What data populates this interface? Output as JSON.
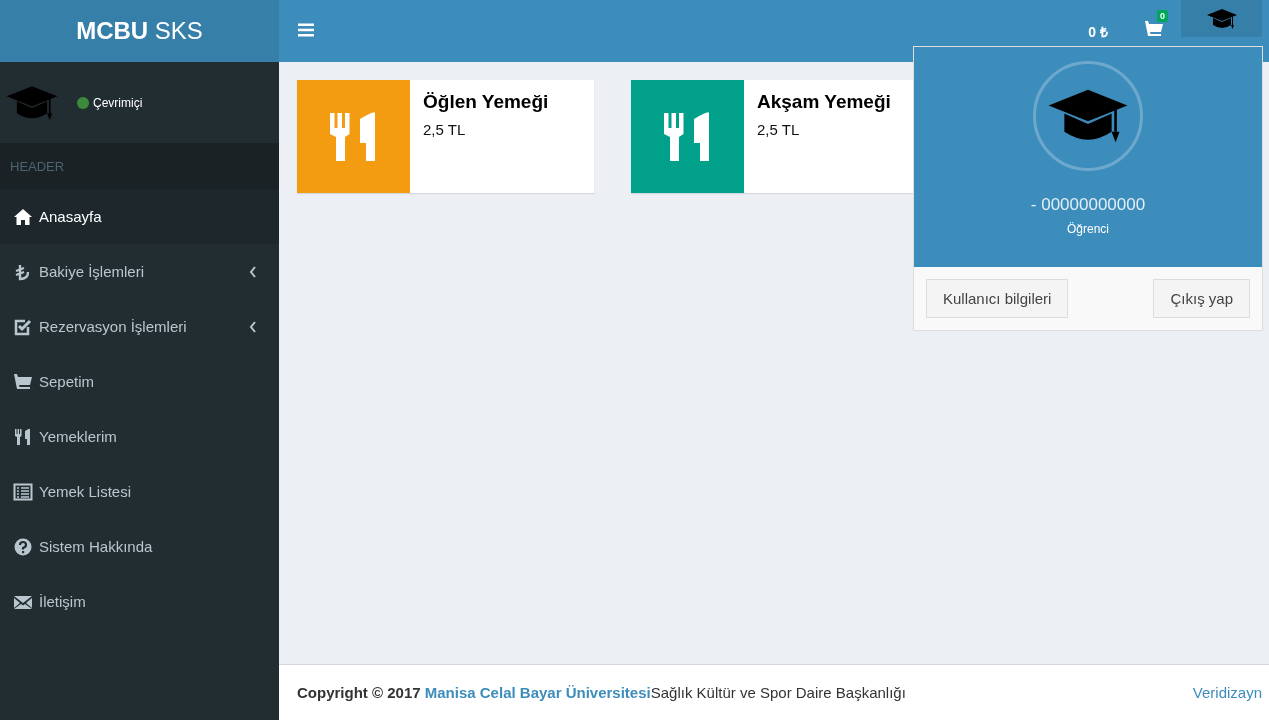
{
  "logo": "**MCBU** SKS",
  "navbar": {
    "balance": "0 ₺",
    "cart_count": "0",
    "user_menu_open": true
  },
  "sidebar": {
    "user": {
      "status": "Çevrimiçi",
      "online": true
    },
    "header": "HEADER",
    "items": [
      {
        "label": "Anasayfa",
        "kind": "home",
        "selected": true,
        "submenu": false
      },
      {
        "label": "Bakiye İşlemleri",
        "kind": "lira",
        "selected": false,
        "submenu": true
      },
      {
        "label": "Rezervasyon İşlemleri",
        "kind": "check",
        "selected": false,
        "submenu": true
      },
      {
        "label": "Sepetim",
        "kind": "cart",
        "selected": false,
        "submenu": false
      },
      {
        "label": "Yemeklerim",
        "kind": "cutlery",
        "selected": false,
        "submenu": false
      },
      {
        "label": "Yemek Listesi",
        "kind": "list",
        "selected": false,
        "submenu": false
      },
      {
        "label": "Sistem Hakkında",
        "kind": "question",
        "selected": false,
        "submenu": false
      },
      {
        "label": "İletişim",
        "kind": "mail",
        "selected": false,
        "submenu": false
      }
    ]
  },
  "meals": [
    {
      "title": "Öğlen Yemeği",
      "price": "2,5 TL",
      "color": "#f39c12"
    },
    {
      "title": "Akşam Yemeği",
      "price": "2,5 TL",
      "color": "#00a08a"
    }
  ],
  "user_dropdown": {
    "id": "- 00000000000",
    "role": "Öğrenci",
    "buttons": [
      "Kullanıcı bilgileri",
      "Çıkış yap"
    ]
  },
  "footer": {
    "copyright": "Copyright © 2017",
    "link": "Manisa Celal Bayar Üniversitesi",
    "text": "Sağlık Kültür ve Spor Daire Başkanlığı",
    "credit": "Veridizayn"
  }
}
